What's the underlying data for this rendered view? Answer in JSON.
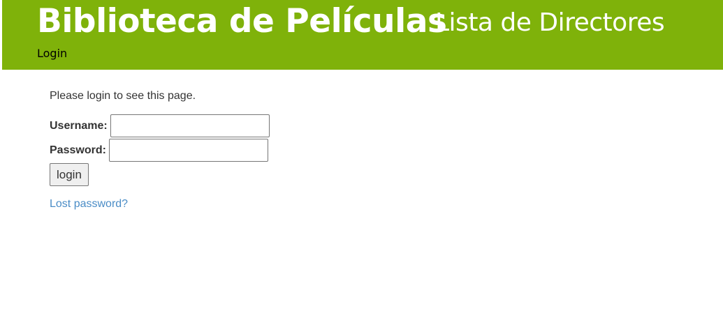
{
  "header": {
    "site_title": "Biblioteca de Películas",
    "page_subtitle": "Lista de Directores",
    "nav_login": "Login",
    "background_color": "#7fb20a"
  },
  "login_form": {
    "message": "Please login to see this page.",
    "username_label": "Username:",
    "username_value": "",
    "password_label": "Password:",
    "password_value": "",
    "submit_label": "login",
    "lost_password_link": "Lost password?",
    "link_color": "#4a8cc6"
  }
}
